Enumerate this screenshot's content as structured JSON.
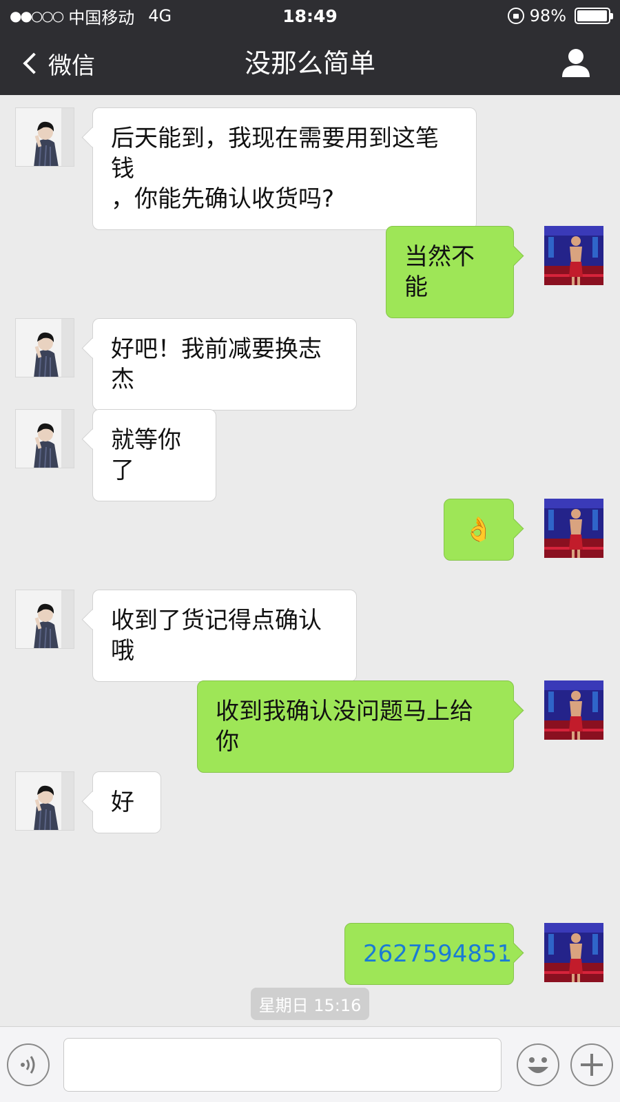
{
  "status_bar": {
    "signal": "●●○○○",
    "carrier": "中国移动",
    "network": "4G",
    "time": "18:49",
    "battery_percent": "98%",
    "battery_level": 0.98
  },
  "nav": {
    "back_label": "微信",
    "title": "没那么简单",
    "profile_icon": "person-icon"
  },
  "messages": [
    {
      "side": "left",
      "lines": [
        "后天能到，我现在需要用到这笔钱",
        "，你能先确认收货吗?"
      ]
    },
    {
      "side": "right",
      "lines": [
        "当然不能"
      ]
    },
    {
      "side": "left",
      "lines": [
        "好吧！我前减要换志杰"
      ]
    },
    {
      "side": "left",
      "lines": [
        "就等你了"
      ]
    },
    {
      "side": "right",
      "lines": [
        "👌"
      ]
    },
    {
      "side": "left",
      "lines": [
        "收到了货记得点确认哦"
      ]
    },
    {
      "side": "right",
      "lines": [
        "收到我确认没问题马上给你"
      ]
    },
    {
      "side": "left",
      "lines": [
        "好"
      ]
    },
    {
      "side": "right",
      "lines": [
        "2627594851"
      ],
      "link": true
    }
  ],
  "timestamp": "星期日 15:16",
  "colors": {
    "header_bg": "#2e2e32",
    "chat_bg": "#ebebeb",
    "self_bubble": "#9ee657",
    "other_bubble": "#ffffff",
    "link": "#1a7bd4"
  },
  "input_bar": {
    "voice_icon": "voice-icon",
    "emoji_icon": "emoji-icon",
    "plus_icon": "plus-icon"
  }
}
